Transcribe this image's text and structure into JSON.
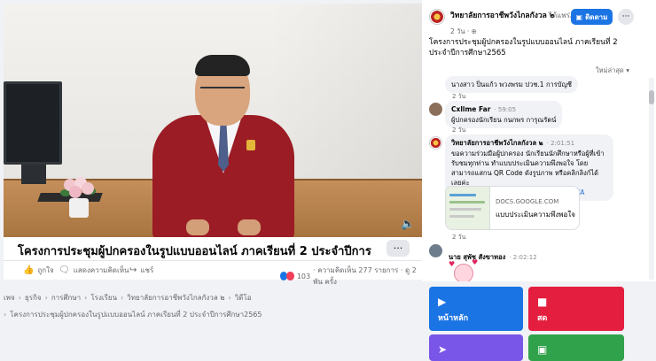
{
  "video": {
    "title": "โครงการประชุมผู้ปกครองในรูปแบบออนไลน์ ภาคเรียนที่ 2 ประจำปีการศึกษา2565",
    "more_label": "···",
    "volume_icon": "volume-icon"
  },
  "actions": {
    "like": "ถูกใจ",
    "comment": "แสดงความคิดเห็น",
    "share": "แชร์",
    "reaction_count": "103",
    "stats": "· ความคิดเห็น 277 รายการ · ดู 2 พัน ครั้ง"
  },
  "breadcrumbs": {
    "items": [
      "เพจ",
      "ธุรกิจ",
      "การศึกษา",
      "โรงเรียน",
      "วิทยาลัยการอาชีพวังไกลกังวล ๒",
      "วิดีโอ"
    ],
    "current": "โครงการประชุมผู้ปกครองในรูปแบบออนไลน์ ภาคเรียนที่ 2 ประจำปีการศึกษา2565"
  },
  "post": {
    "page_name": "วิทยาลัยการอาชีพวังไกลกังวล ๒",
    "with_text": "ได้แพร่ภาพสด",
    "time": "2 วัน · ⊕",
    "follow_label": "ติดตาม",
    "text": "โครงการประชุมผู้ปกครองในรูปแบบออนไลน์ ภาคเรียนที่ 2 ประจำปีการศึกษา2565",
    "sort_label": "ใหม่ล่าสุด ▾"
  },
  "comments": [
    {
      "name": "",
      "time": "",
      "text": "นางสาว ปิ่นแก้ว พวงพรม ปวช.1 การบัญชี",
      "meta": "2 วัน"
    },
    {
      "name": "Cxllme Far",
      "time": "· 59:05",
      "text": "ผู้ปกครองนักเรียน กนกพร การุณรัตน์",
      "meta": "2 วัน"
    },
    {
      "name": "วิทยาลัยการอาชีพวังไกลกังวล ๒",
      "time": "· 2:01:51",
      "text": "ขอความร่วมมือผู้ปกครอง นักเรียนนักศึกษาหรือผู้ที่เข้ารับชมทุกท่าน ทำแบบประเมินความพึงพอใจ โดยสามารถแสกน QR Code ดังรูปภาพ หรือคลิกลิงก์ได้เลยค่ะ",
      "link": "https://forms.gle/YBTmFP7pAMK4SKCKA",
      "meta": "2 วัน"
    },
    {
      "name": "นาย สุพัช สังขาทอง",
      "time": "· 2:02:12",
      "text": "",
      "meta": ""
    }
  ],
  "link_card": {
    "domain": "DOCS.GOOGLE.COM",
    "title": "แบบประเมินความพึงพอใจ"
  },
  "tiles": [
    {
      "label": "หน้าหลัก",
      "icon": "home-icon",
      "color": "#1b74e4"
    },
    {
      "label": "สด",
      "icon": "video-camera-icon",
      "color": "#e41e3f"
    },
    {
      "label": "",
      "icon": "send-icon",
      "color": "#7a56e8"
    },
    {
      "label": "",
      "icon": "bookmark-icon",
      "color": "#31a24c"
    }
  ]
}
